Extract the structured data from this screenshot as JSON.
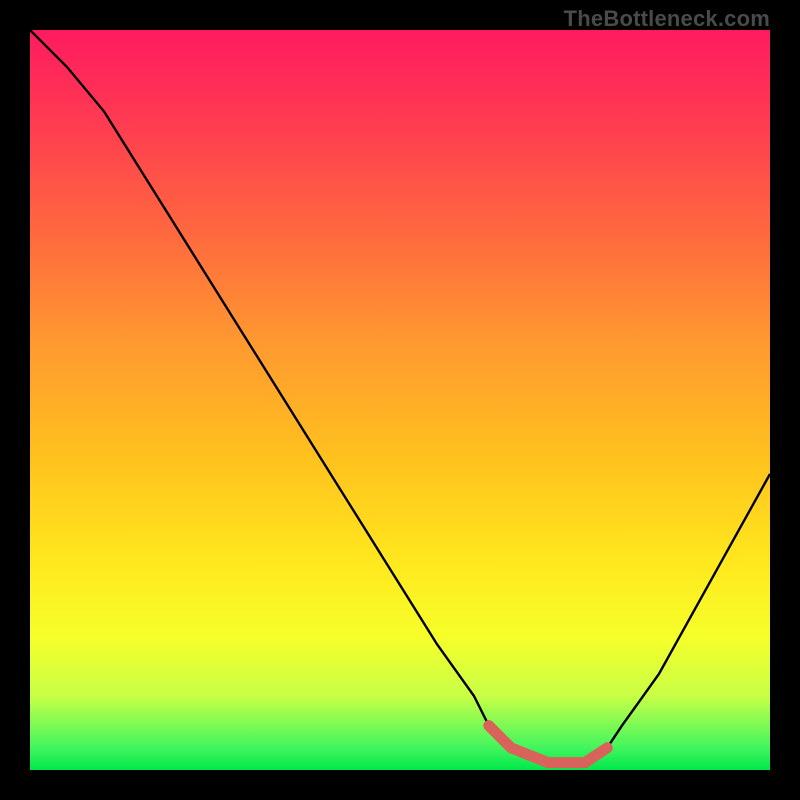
{
  "watermark": "TheBottleneck.com",
  "chart_data": {
    "type": "line",
    "title": "",
    "xlabel": "",
    "ylabel": "",
    "xlim": [
      0,
      100
    ],
    "ylim": [
      0,
      100
    ],
    "grid": false,
    "legend_position": "none",
    "annotations": [],
    "series": [
      {
        "name": "bottleneck-curve",
        "color": "#000000",
        "x": [
          0,
          5,
          10,
          15,
          20,
          25,
          30,
          35,
          40,
          45,
          50,
          55,
          60,
          62,
          65,
          70,
          75,
          78,
          80,
          85,
          90,
          95,
          100
        ],
        "y": [
          100,
          95,
          89,
          81,
          73,
          65,
          57,
          49,
          41,
          33,
          25,
          17,
          10,
          6,
          3,
          1,
          1,
          3,
          6,
          13,
          22,
          31,
          40
        ]
      },
      {
        "name": "highlight-band",
        "color": "#d9635b",
        "x": [
          62,
          65,
          70,
          75,
          78
        ],
        "y": [
          6,
          3,
          1,
          1,
          3
        ]
      }
    ],
    "background_gradient": {
      "top": "#ff1a60",
      "bottom": "#00e84a",
      "meaning": "red-high-bottleneck to green-low-bottleneck"
    }
  }
}
